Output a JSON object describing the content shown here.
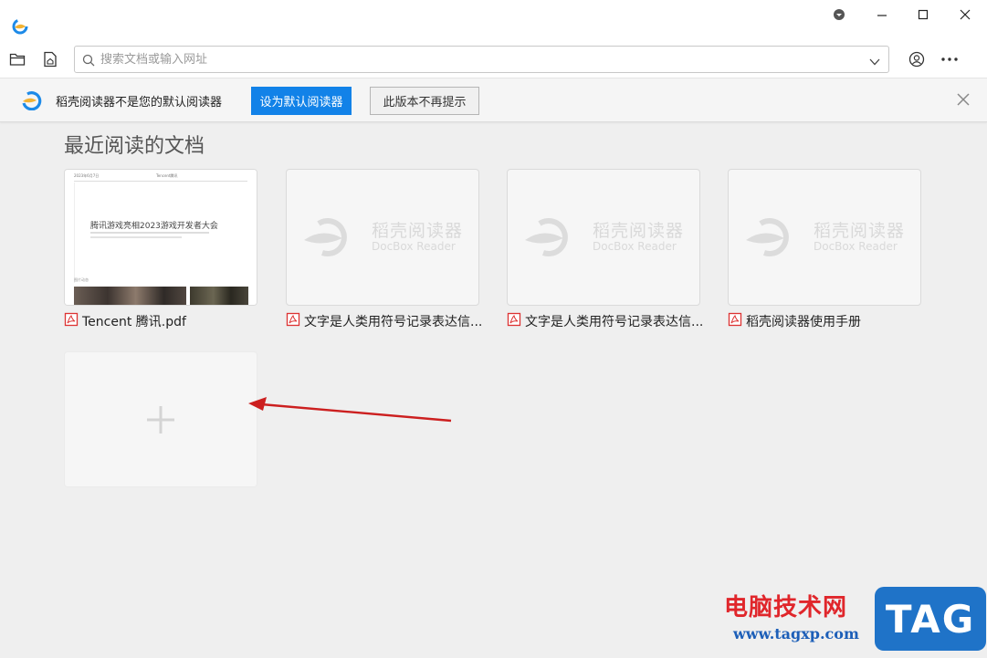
{
  "window": {
    "app_logo_icon": "docbox-logo-icon",
    "controls": [
      "dropdown-icon",
      "minimize-icon",
      "maximize-icon",
      "close-icon"
    ]
  },
  "toolbar": {
    "open_folder_icon": "folder-icon",
    "home_icon": "home-document-icon",
    "search": {
      "placeholder": "搜索文档或输入网址",
      "value": ""
    },
    "account_icon": "user-circle-icon",
    "more_icon": "more-horizontal-icon"
  },
  "notice": {
    "text": "稻壳阅读器不是您的默认阅读器",
    "set_default_label": "设为默认阅读器",
    "dismiss_label": "此版本不再提示",
    "colors": {
      "primary_button": "#1282e8"
    }
  },
  "main": {
    "section_title": "最近阅读的文档",
    "documents": [
      {
        "name": "Tencent 腾讯.pdf",
        "thumbnail": "pdf-preview",
        "thumb_text": {
          "header_left": "2023年6月7日",
          "header_right": "Tencent腾讯",
          "title": "腾讯游戏亮相2023游戏开发者大会",
          "section_label": "图片动态"
        }
      },
      {
        "name": "文字是人类用符号记录表达信...",
        "thumbnail": "placeholder"
      },
      {
        "name": "文字是人类用符号记录表达信...",
        "thumbnail": "placeholder"
      },
      {
        "name": "稻壳阅读器使用手册",
        "thumbnail": "placeholder"
      }
    ],
    "placeholder_brand": {
      "cn": "稻壳阅读器",
      "en": "DocBox Reader"
    },
    "add_card_icon": "plus-icon"
  },
  "watermark": {
    "cn": "电脑技术网",
    "url": "www.tagxp.com",
    "tag": "TAG"
  }
}
